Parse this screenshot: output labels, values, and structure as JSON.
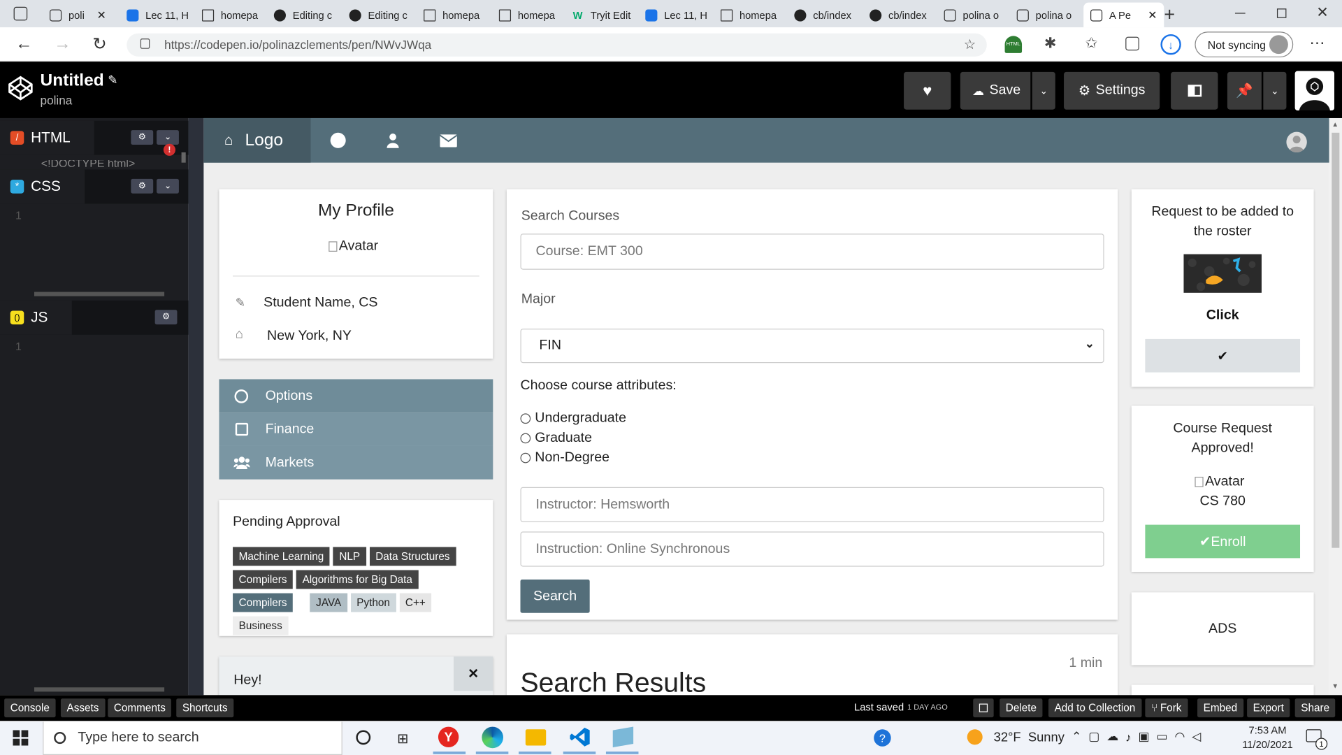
{
  "browser": {
    "tabs": [
      {
        "label": "poli",
        "icon": "codepen-icon"
      },
      {
        "label": "Lec 11, H",
        "icon": "user-icon"
      },
      {
        "label": "homepa",
        "icon": "doc-icon"
      },
      {
        "label": "Editing c",
        "icon": "github-icon"
      },
      {
        "label": "Editing c",
        "icon": "github-icon"
      },
      {
        "label": "homepa",
        "icon": "doc-icon"
      },
      {
        "label": "homepa",
        "icon": "doc-icon"
      },
      {
        "label": "Tryit Edit",
        "icon": "w3-icon"
      },
      {
        "label": "Lec 11, H",
        "icon": "user-icon"
      },
      {
        "label": "homepa",
        "icon": "doc-icon"
      },
      {
        "label": "cb/index",
        "icon": "github-icon"
      },
      {
        "label": "cb/index",
        "icon": "github-icon"
      },
      {
        "label": "polina o",
        "icon": "codepen-icon"
      },
      {
        "label": "polina o",
        "icon": "codepen-icon"
      },
      {
        "label": "A Pe",
        "icon": "codepen-icon"
      }
    ],
    "url": "https://codepen.io/polinazclements/pen/NWvJWqa",
    "sync_label": "Not syncing",
    "ext_badge": "HTML"
  },
  "codepen": {
    "title": "Untitled",
    "user": "polina",
    "save_label": "Save",
    "settings_label": "Settings",
    "panels": {
      "html": "HTML",
      "css": "CSS",
      "js": "JS"
    },
    "html_snippet": "<!DOCTYPE html>",
    "line_one": "1",
    "footer": {
      "left": [
        "Console",
        "Assets",
        "Comments",
        "Shortcuts"
      ],
      "last_saved": "Last saved",
      "last_saved_ago": "1 DAY AGO",
      "right": [
        "Delete",
        "Add to Collection",
        "Fork",
        "Embed",
        "Export",
        "Share"
      ]
    }
  },
  "preview": {
    "nav": {
      "logo": "Logo"
    },
    "profile": {
      "title": "My Profile",
      "avatar_alt": "Avatar",
      "name": "Student Name, CS",
      "location": "New York, NY"
    },
    "menu": [
      "Options",
      "Finance",
      "Markets"
    ],
    "pending": {
      "title": "Pending Approval",
      "tags_dark": [
        "Machine Learning",
        "NLP",
        "Data Structures",
        "Compilers",
        "Algorithms for Big Data",
        "Compilers"
      ],
      "tags_light": [
        "JAVA",
        "Python",
        "C++",
        "Business"
      ]
    },
    "alert": {
      "text": "Hey!",
      "close": "×"
    },
    "search": {
      "label": "Search Courses",
      "course_placeholder": "Course: EMT 300",
      "major_label": "Major",
      "major_value": "FIN",
      "attr_label": "Choose course attributes:",
      "attrs": [
        "Undergraduate",
        "Graduate",
        "Non-Degree"
      ],
      "instructor_placeholder": "Instructor: Hemsworth",
      "instruction_placeholder": "Instruction: Online Synchronous",
      "button": "Search"
    },
    "results": {
      "title": "Search Results",
      "time": "1 min"
    },
    "roster": {
      "title": "Request to be added to the roster",
      "click": "Click",
      "check": "✔"
    },
    "approved": {
      "title": "Course Request Approved!",
      "avatar_alt": "Avatar",
      "course": "CS 780",
      "enroll": "✔Enroll"
    },
    "ads": "ADS"
  },
  "taskbar": {
    "search_placeholder": "Type here to search",
    "weather": "32°F  Sunny",
    "time": "7:53 AM",
    "date": "11/20/2021",
    "notif": "1"
  },
  "colors": {
    "nav": "#546e7a",
    "menu": "#7a96a3",
    "enroll": "#7fcf8f",
    "html": "#e44d26",
    "css": "#2ea9e0",
    "js": "#f7df1e"
  }
}
